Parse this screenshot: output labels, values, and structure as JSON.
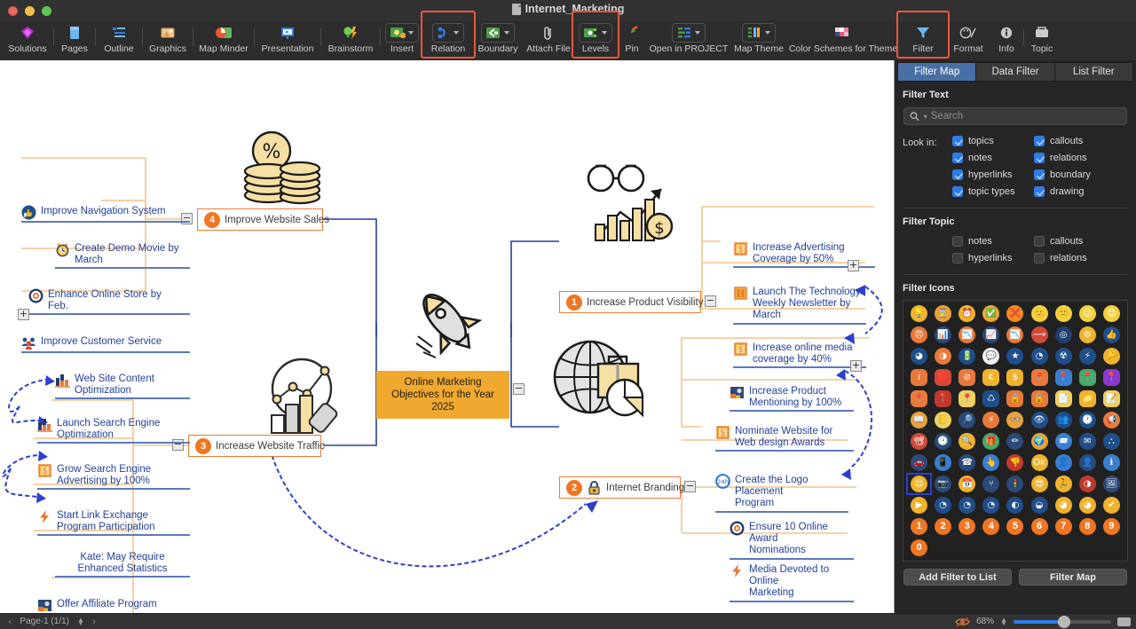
{
  "window": {
    "title": "Internet_Marketing",
    "doc_icon": "document-icon"
  },
  "toolbar": {
    "items": [
      {
        "label": "Solutions",
        "icon": "solutions-icon",
        "dropdown": false,
        "boxed": false,
        "highlight": false
      },
      {
        "label": "Pages",
        "icon": "pages-icon",
        "dropdown": false,
        "boxed": false,
        "highlight": false
      },
      {
        "label": "Outline",
        "icon": "outline-icon",
        "dropdown": false,
        "boxed": false,
        "highlight": false
      },
      {
        "label": "Graphics",
        "icon": "graphics-icon",
        "dropdown": false,
        "boxed": false,
        "highlight": false
      },
      {
        "label": "Map Minder",
        "icon": "map-minder-icon",
        "dropdown": false,
        "boxed": false,
        "highlight": false
      },
      {
        "label": "Presentation",
        "icon": "presentation-icon",
        "dropdown": false,
        "boxed": false,
        "highlight": false
      },
      {
        "label": "Brainstorm",
        "icon": "brainstorm-icon",
        "dropdown": false,
        "boxed": false,
        "highlight": false
      },
      {
        "label": "Insert",
        "icon": "insert-icon",
        "dropdown": true,
        "boxed": true,
        "highlight": false
      },
      {
        "label": "Relation",
        "icon": "relation-icon",
        "dropdown": true,
        "boxed": true,
        "highlight": true
      },
      {
        "label": "Boundary",
        "icon": "boundary-icon",
        "dropdown": true,
        "boxed": true,
        "highlight": false
      },
      {
        "label": "Attach File",
        "icon": "attach-file-icon",
        "dropdown": false,
        "boxed": false,
        "highlight": false
      },
      {
        "label": "Levels",
        "icon": "levels-icon",
        "dropdown": true,
        "boxed": true,
        "highlight": true
      },
      {
        "label": "Pin",
        "icon": "pin-icon",
        "dropdown": false,
        "boxed": false,
        "highlight": false
      },
      {
        "label": "Open in PROJECT",
        "icon": "open-in-project-icon",
        "dropdown": true,
        "boxed": true,
        "highlight": false
      },
      {
        "label": "Map Theme",
        "icon": "map-theme-icon",
        "dropdown": true,
        "boxed": true,
        "highlight": false
      },
      {
        "label": "Color Schemes for Theme",
        "icon": "color-schemes-icon",
        "dropdown": false,
        "boxed": false,
        "highlight": false
      },
      {
        "label": "Filter",
        "icon": "filter-icon",
        "dropdown": false,
        "boxed": false,
        "highlight": true
      },
      {
        "label": "Format",
        "icon": "format-icon",
        "dropdown": false,
        "boxed": false,
        "highlight": false
      },
      {
        "label": "Info",
        "icon": "info-icon",
        "dropdown": false,
        "boxed": false,
        "highlight": false
      },
      {
        "label": "Topic",
        "icon": "topic-icon",
        "dropdown": false,
        "boxed": false,
        "highlight": false
      }
    ]
  },
  "map": {
    "central": {
      "line1": "Online Marketing",
      "line2": "Objectives for the Year 2025"
    },
    "branches": [
      {
        "badge": "4",
        "label": "Improve Website Sales",
        "lock": false
      },
      {
        "badge": "3",
        "label": "Increase Website Traffic",
        "lock": false
      },
      {
        "badge": "1",
        "label": "Increase Product Visibility",
        "lock": false
      },
      {
        "badge": "2",
        "label": "Internet Branding",
        "lock": true
      }
    ],
    "sales_children": [
      {
        "text": "Improve Navigation System",
        "icon": "thumbs-up-icon"
      },
      {
        "text": "Create Demo Movie by\nMarch",
        "icon": "alarm-clock-icon"
      },
      {
        "text": "Enhance Online Store by\nFeb.",
        "icon": "target-icon"
      },
      {
        "text": "Improve Customer Service",
        "icon": "people-icon"
      }
    ],
    "traffic_children": [
      {
        "text": "Web Site Content\nOptimization",
        "icon": "bar-chart-icon"
      },
      {
        "text": "Launch Search Engine\nOptimization",
        "icon": "bar-chart-icon"
      },
      {
        "text": "Grow Search Engine\nAdvertising by 100%",
        "icon": "dollar-note-icon"
      },
      {
        "text": "Start Link Exchange\nProgram Participation",
        "icon": "lightning-icon"
      },
      {
        "text": "Kate: May Require\nEnhanced Statistics",
        "icon": "none"
      },
      {
        "text": "Offer Affiliate Program",
        "icon": "contact-photo-icon"
      }
    ],
    "visibility_children": [
      {
        "text": "Increase Advertising\nCoverage by 50%",
        "icon": "dollar-note-icon"
      },
      {
        "text": "Launch The Technology\nWeekly Newsletter by\nMarch",
        "icon": "book-icon"
      },
      {
        "text": "Increase online media\ncoverage by 40%",
        "icon": "dollar-note-icon"
      }
    ],
    "branding_children": [
      {
        "text": "Increase Product\nMentioning by 100%",
        "icon": "contact-photo-icon"
      },
      {
        "text": "Nominate Website for\nWeb design Awards",
        "icon": "dollar-note-icon"
      },
      {
        "text": "Create the Logo Placement\nProgram",
        "icon": "24h-icon"
      },
      {
        "text": "Ensure 10 Online Award\nNominations",
        "icon": "target-icon"
      },
      {
        "text": "Media Devoted to Online\nMarketing",
        "icon": "lightning-icon"
      }
    ]
  },
  "panel": {
    "tabs": [
      {
        "label": "Filter Map",
        "active": true
      },
      {
        "label": "Data Filter",
        "active": false
      },
      {
        "label": "List Filter",
        "active": false
      }
    ],
    "filter_text_title": "Filter Text",
    "search": {
      "placeholder": "Search",
      "value": "",
      "icon": "search-icon"
    },
    "look_in_label": "Look in:",
    "look_in": [
      {
        "label": "topics",
        "checked": true
      },
      {
        "label": "callouts",
        "checked": true
      },
      {
        "label": "notes",
        "checked": true
      },
      {
        "label": "relations",
        "checked": true
      },
      {
        "label": "hyperlinks",
        "checked": true
      },
      {
        "label": "boundary",
        "checked": true
      },
      {
        "label": "topic types",
        "checked": true
      },
      {
        "label": "drawing",
        "checked": true
      }
    ],
    "filter_topic_title": "Filter Topic",
    "filter_topic": [
      {
        "label": "notes",
        "checked": false
      },
      {
        "label": "callouts",
        "checked": false
      },
      {
        "label": "hyperlinks",
        "checked": false
      },
      {
        "label": "relations",
        "checked": false
      }
    ],
    "filter_icons_title": "Filter Icons",
    "icons": [
      {
        "name": "light-bulb-icon",
        "glyph": "💡",
        "selected": false
      },
      {
        "name": "hourglass-icon",
        "glyph": "⌛",
        "selected": false
      },
      {
        "name": "alarm-clock-icon",
        "glyph": "⏰",
        "selected": false
      },
      {
        "name": "check-circle-icon",
        "glyph": "✅",
        "selected": false
      },
      {
        "name": "cross-circle-icon",
        "glyph": "❌",
        "selected": false
      },
      {
        "name": "smiley-happy-icon",
        "glyph": "🙂",
        "selected": false
      },
      {
        "name": "smiley-sad-icon",
        "glyph": "🙁",
        "selected": false
      },
      {
        "name": "smiley-frown-icon",
        "glyph": "😕",
        "selected": false
      },
      {
        "name": "smiley-worried-icon",
        "glyph": "😟",
        "selected": false
      },
      {
        "name": "smiley-angry-icon",
        "glyph": "😠",
        "selected": false
      },
      {
        "name": "bar-chart-up-icon",
        "glyph": "📊",
        "selected": false
      },
      {
        "name": "bar-chart-down-icon",
        "glyph": "📉",
        "selected": false
      },
      {
        "name": "bar-chart-flat-icon",
        "glyph": "📈",
        "selected": false
      },
      {
        "name": "chart-decline-icon",
        "glyph": "📉",
        "selected": false
      },
      {
        "name": "arrow-right-icon",
        "glyph": "⟶",
        "selected": false
      },
      {
        "name": "target-icon",
        "glyph": "◎",
        "selected": false
      },
      {
        "name": "gear-icon",
        "glyph": "⚙",
        "selected": false
      },
      {
        "name": "thumbs-up-icon",
        "glyph": "👍",
        "selected": false
      },
      {
        "name": "pie-chart-quarter-icon",
        "glyph": "◕",
        "selected": false
      },
      {
        "name": "pie-chart-half-icon",
        "glyph": "◑",
        "selected": false
      },
      {
        "name": "battery-icon",
        "glyph": "🔋",
        "selected": false
      },
      {
        "name": "speech-bubble-icon",
        "glyph": "💬",
        "selected": false
      },
      {
        "name": "star-icon",
        "glyph": "★",
        "selected": false
      },
      {
        "name": "pie-chart-icon",
        "glyph": "◔",
        "selected": false
      },
      {
        "name": "radiation-icon",
        "glyph": "☢",
        "selected": false
      },
      {
        "name": "lightning-icon",
        "glyph": "⚡",
        "selected": false
      },
      {
        "name": "key-icon",
        "glyph": "🔑",
        "selected": false
      },
      {
        "name": "info-italic-icon",
        "glyph": "𝑖",
        "selected": false
      },
      {
        "name": "stop-sign-icon",
        "glyph": "🛑",
        "selected": false
      },
      {
        "name": "no-entry-icon",
        "glyph": "⊘",
        "selected": false
      },
      {
        "name": "euro-note-icon",
        "glyph": "€",
        "selected": false
      },
      {
        "name": "dollar-note-icon",
        "glyph": "$",
        "selected": false
      },
      {
        "name": "map-pin-orange-icon",
        "glyph": "📍",
        "selected": false
      },
      {
        "name": "map-pin-blue-icon",
        "glyph": "📍",
        "selected": false
      },
      {
        "name": "map-pin-green-icon",
        "glyph": "📍",
        "selected": false
      },
      {
        "name": "map-pin-purple-icon",
        "glyph": "📍",
        "selected": false
      },
      {
        "name": "map-pin-amber-icon",
        "glyph": "📍",
        "selected": false
      },
      {
        "name": "map-pin-red-icon",
        "glyph": "📍",
        "selected": false
      },
      {
        "name": "map-pin-yellow-icon",
        "glyph": "📍",
        "selected": false
      },
      {
        "name": "recycle-icon",
        "glyph": "♺",
        "selected": false
      },
      {
        "name": "lock-closed-icon",
        "glyph": "🔒",
        "selected": false
      },
      {
        "name": "lock-open-icon",
        "glyph": "🔓",
        "selected": false
      },
      {
        "name": "document-delete-icon",
        "glyph": "📄",
        "selected": false
      },
      {
        "name": "folder-icon",
        "glyph": "📁",
        "selected": false
      },
      {
        "name": "document-edit-icon",
        "glyph": "📝",
        "selected": false
      },
      {
        "name": "book-icon",
        "glyph": "📖",
        "selected": false
      },
      {
        "name": "note-bulb-icon",
        "glyph": "📒",
        "selected": false
      },
      {
        "name": "search-document-icon",
        "glyph": "🔎",
        "selected": false
      },
      {
        "name": "lightning-bolt-icon",
        "glyph": "⚡",
        "selected": false
      },
      {
        "name": "glasses-icon",
        "glyph": "👓",
        "selected": false
      },
      {
        "name": "eye-icon",
        "glyph": "👁",
        "selected": false
      },
      {
        "name": "group-icon",
        "glyph": "👥",
        "selected": false
      },
      {
        "name": "24h-icon",
        "glyph": "🕐",
        "selected": false
      },
      {
        "name": "megaphone-icon",
        "glyph": "📢",
        "selected": false
      },
      {
        "name": "presentation-icon",
        "glyph": "📽",
        "selected": false
      },
      {
        "name": "speedometer-icon",
        "glyph": "🕑",
        "selected": false
      },
      {
        "name": "magnifier-icon",
        "glyph": "🔍",
        "selected": false
      },
      {
        "name": "gift-icon",
        "glyph": "🎁",
        "selected": false
      },
      {
        "name": "pencil-tools-icon",
        "glyph": "✏",
        "selected": false
      },
      {
        "name": "globe-icon",
        "glyph": "🌍",
        "selected": false
      },
      {
        "name": "mail-open-icon",
        "glyph": "📨",
        "selected": false
      },
      {
        "name": "mail-icon",
        "glyph": "✉",
        "selected": false
      },
      {
        "name": "org-chart-icon",
        "glyph": "⛬",
        "selected": false
      },
      {
        "name": "car-icon",
        "glyph": "🚗",
        "selected": false
      },
      {
        "name": "mobile-icon",
        "glyph": "📱",
        "selected": false
      },
      {
        "name": "phone-icon",
        "glyph": "☎",
        "selected": false
      },
      {
        "name": "hand-point-icon",
        "glyph": "👆",
        "selected": false
      },
      {
        "name": "thumbs-down-icon",
        "glyph": "👎",
        "selected": false
      },
      {
        "name": "ok-icon",
        "glyph": "Ok",
        "selected": false
      },
      {
        "name": "person-icon",
        "glyph": "👤",
        "selected": false
      },
      {
        "name": "user-silhouette-icon",
        "glyph": "👤",
        "selected": false
      },
      {
        "name": "info-circle-icon",
        "glyph": "ℹ",
        "selected": false
      },
      {
        "name": "smiley-heart-icon",
        "glyph": "😍",
        "selected": true
      },
      {
        "name": "camera-icon",
        "glyph": "📷",
        "selected": false
      },
      {
        "name": "calendar-10-icon",
        "glyph": "📅",
        "selected": false
      },
      {
        "name": "branch-icon",
        "glyph": "⑂",
        "selected": false
      },
      {
        "name": "traffic-light-icon",
        "glyph": "🚦",
        "selected": false
      },
      {
        "name": "smiley-sunglasses-icon",
        "glyph": "😎",
        "selected": false
      },
      {
        "name": "runner-icon",
        "glyph": "🏃",
        "selected": false
      },
      {
        "name": "contrast-icon",
        "glyph": "◑",
        "selected": false
      },
      {
        "name": "contact-photo-icon",
        "glyph": "🖼",
        "selected": false
      },
      {
        "name": "play-icon",
        "glyph": "▶",
        "selected": false
      },
      {
        "name": "pie-12-icon",
        "glyph": "◔",
        "selected": false
      },
      {
        "name": "pie-25-icon",
        "glyph": "◔",
        "selected": false
      },
      {
        "name": "pie-37-icon",
        "glyph": "◔",
        "selected": false
      },
      {
        "name": "pie-50-icon",
        "glyph": "◐",
        "selected": false
      },
      {
        "name": "pie-62-icon",
        "glyph": "◒",
        "selected": false
      },
      {
        "name": "pie-75-icon",
        "glyph": "◕",
        "selected": false
      },
      {
        "name": "pie-87-icon",
        "glyph": "◕",
        "selected": false
      },
      {
        "name": "check-mark-icon",
        "glyph": "✔",
        "selected": false
      },
      {
        "name": "number-1-icon",
        "glyph": "1",
        "selected": false
      },
      {
        "name": "number-2-icon",
        "glyph": "2",
        "selected": false
      },
      {
        "name": "number-3-icon",
        "glyph": "3",
        "selected": false
      },
      {
        "name": "number-4-icon",
        "glyph": "4",
        "selected": false
      },
      {
        "name": "number-5-icon",
        "glyph": "5",
        "selected": false
      },
      {
        "name": "number-6-icon",
        "glyph": "6",
        "selected": false
      },
      {
        "name": "number-7-icon",
        "glyph": "7",
        "selected": false
      },
      {
        "name": "number-8-icon",
        "glyph": "8",
        "selected": false
      },
      {
        "name": "number-9-icon",
        "glyph": "9",
        "selected": false
      },
      {
        "name": "number-0-icon",
        "glyph": "0",
        "selected": false
      }
    ],
    "add_filter_button": "Add Filter to List",
    "filter_map_button": "Filter Map"
  },
  "status": {
    "page": "Page-1 (1/1)",
    "prev": "‹",
    "next": "›",
    "zoom": "68%",
    "hide_icon": "hidden-eye-icon",
    "fit_icon": "fit-page-icon"
  },
  "colors": {
    "accent_orange": "#ed7d31",
    "central_yellow": "#f0a92e",
    "link_blue": "#23409a",
    "highlight_red": "#f2553d",
    "tab_blue": "#4a6fa5",
    "checkbox_blue": "#2f7ce8"
  }
}
